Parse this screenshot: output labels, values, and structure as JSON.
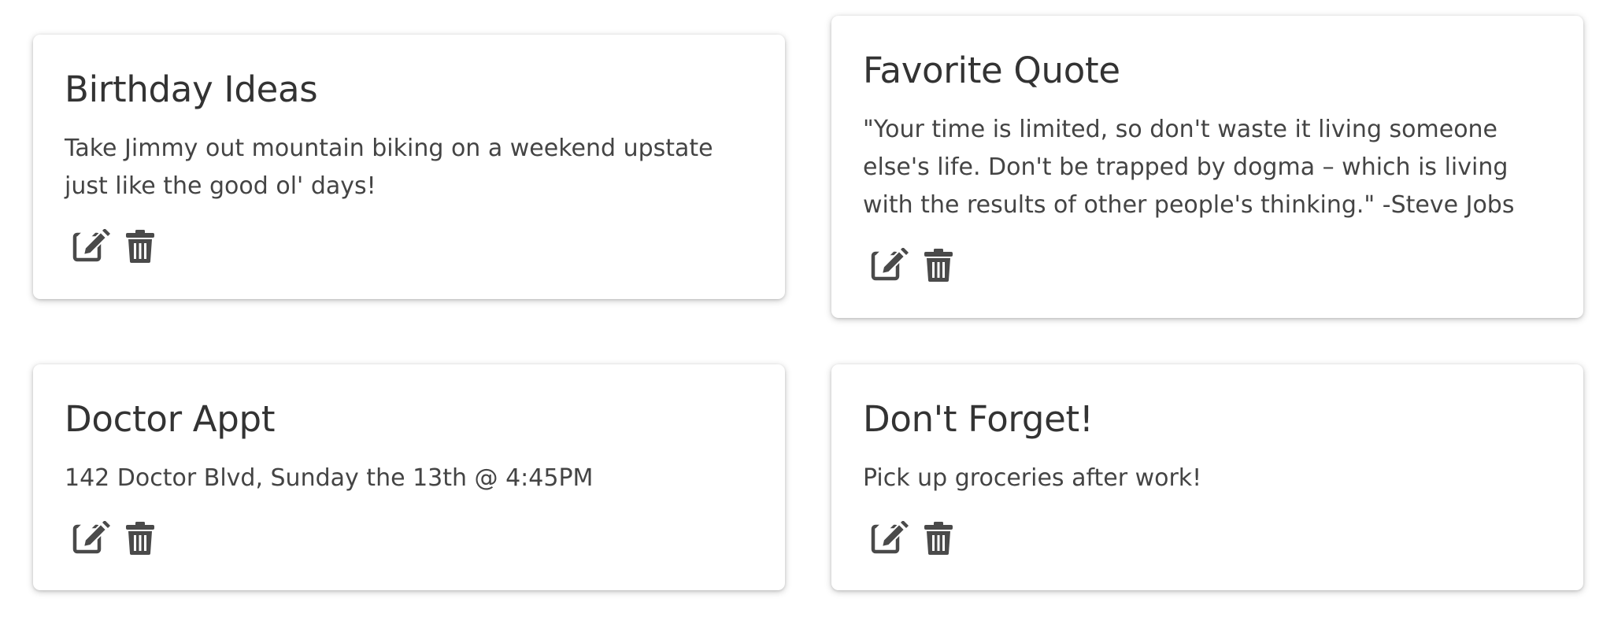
{
  "notes": [
    {
      "title": "Birthday Ideas",
      "content": "Take Jimmy out mountain biking on a weekend upstate just like the good ol' days!"
    },
    {
      "title": "Favorite Quote",
      "content": "\"Your time is limited, so don't waste it living someone else's life. Don't be trapped by dogma – which is living with the results of other people's thinking.\" -Steve Jobs"
    },
    {
      "title": "Doctor Appt",
      "content": "142 Doctor Blvd, Sunday the 13th @ 4:45PM"
    },
    {
      "title": "Don't Forget!",
      "content": "Pick up groceries after work!"
    }
  ],
  "icons": {
    "edit": "edit-icon",
    "delete": "trash-icon"
  },
  "colors": {
    "icon": "#4a4a4a",
    "text": "#444444",
    "title": "#333333"
  }
}
